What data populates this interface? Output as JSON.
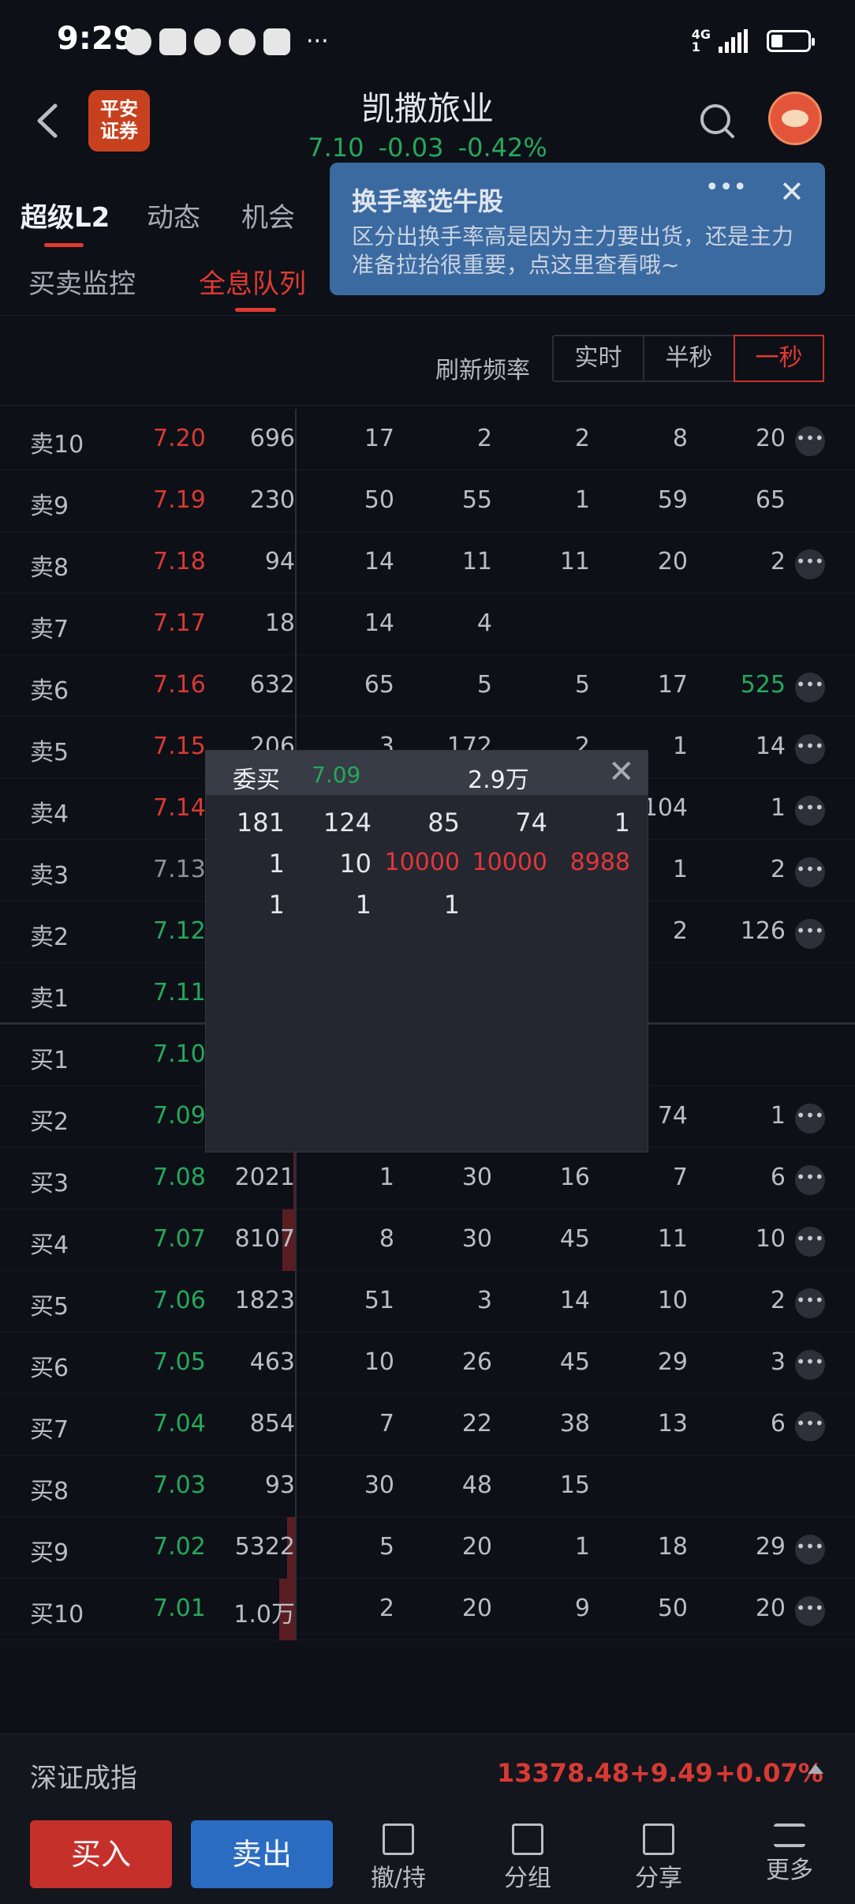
{
  "status_bar": {
    "time": "9:29",
    "network": "4G",
    "network_sub": "1"
  },
  "header": {
    "logo_line1": "平安",
    "logo_line2": "证券",
    "stock_name": "凯撒旅业",
    "price": "7.10",
    "change": "-0.03",
    "change_pct": "-0.42%"
  },
  "tabs": [
    "超级L2",
    "动态",
    "机会"
  ],
  "subtabs": [
    "买卖监控",
    "全息队列"
  ],
  "banner": {
    "title": "换手率选牛股",
    "text": "区分出换手率高是因为主力要出货，还是主力准备拉抬很重要，点这里查看哦~"
  },
  "refresh": {
    "label": "刷新频率",
    "options": [
      "实时",
      "半秒",
      "一秒"
    ],
    "selected": "一秒"
  },
  "book": {
    "rows": [
      {
        "label": "卖10",
        "price": "7.20",
        "vol": "696",
        "q": [
          "17",
          "2",
          "2",
          "8",
          "20"
        ],
        "more": true
      },
      {
        "label": "卖9",
        "price": "7.19",
        "vol": "230",
        "q": [
          "50",
          "55",
          "1",
          "59",
          "65"
        ],
        "more": false
      },
      {
        "label": "卖8",
        "price": "7.18",
        "vol": "94",
        "q": [
          "14",
          "11",
          "11",
          "20",
          "2"
        ],
        "more": true
      },
      {
        "label": "卖7",
        "price": "7.17",
        "vol": "18",
        "q": [
          "14",
          "4",
          "",
          "",
          ""
        ],
        "more": false
      },
      {
        "label": "卖6",
        "price": "7.16",
        "vol": "632",
        "q": [
          "65",
          "5",
          "5",
          "17",
          "525"
        ],
        "more": true
      },
      {
        "label": "卖5",
        "price": "7.15",
        "vol": "206",
        "q": [
          "3",
          "172",
          "2",
          "1",
          "14"
        ],
        "more": true
      },
      {
        "label": "卖4",
        "price": "7.14",
        "vol": "",
        "q": [
          "",
          "",
          "",
          "104",
          "1"
        ],
        "more": true
      },
      {
        "label": "卖3",
        "price": "7.13",
        "vol": "",
        "q": [
          "",
          "",
          "",
          "1",
          "2"
        ],
        "more": true
      },
      {
        "label": "卖2",
        "price": "7.12",
        "vol": "",
        "q": [
          "",
          "",
          "",
          "2",
          "126"
        ],
        "more": true
      },
      {
        "label": "卖1",
        "price": "7.11",
        "vol": "",
        "q": [
          "",
          "",
          "",
          "",
          ""
        ],
        "more": false
      },
      {
        "label": "买1",
        "price": "7.10",
        "vol": "",
        "q": [
          "",
          "",
          "",
          "",
          ""
        ],
        "more": false
      },
      {
        "label": "买2",
        "price": "7.09",
        "vol": "",
        "q": [
          "",
          "",
          "",
          "74",
          "1"
        ],
        "more": true
      },
      {
        "label": "买3",
        "price": "7.08",
        "vol": "2021",
        "q": [
          "1",
          "30",
          "16",
          "7",
          "6"
        ],
        "more": true
      },
      {
        "label": "买4",
        "price": "7.07",
        "vol": "8107",
        "q": [
          "8",
          "30",
          "45",
          "11",
          "10"
        ],
        "more": true
      },
      {
        "label": "买5",
        "price": "7.06",
        "vol": "1823",
        "q": [
          "51",
          "3",
          "14",
          "10",
          "2"
        ],
        "more": true
      },
      {
        "label": "买6",
        "price": "7.05",
        "vol": "463",
        "q": [
          "10",
          "26",
          "45",
          "29",
          "3"
        ],
        "more": true
      },
      {
        "label": "买7",
        "price": "7.04",
        "vol": "854",
        "q": [
          "7",
          "22",
          "38",
          "13",
          "6"
        ],
        "more": true
      },
      {
        "label": "买8",
        "price": "7.03",
        "vol": "93",
        "q": [
          "30",
          "48",
          "15",
          "",
          ""
        ],
        "more": false
      },
      {
        "label": "买9",
        "price": "7.02",
        "vol": "5322",
        "q": [
          "5",
          "20",
          "1",
          "18",
          "29"
        ],
        "more": true
      },
      {
        "label": "买10",
        "price": "7.01",
        "vol": "1.0万",
        "q": [
          "2",
          "20",
          "9",
          "50",
          "20"
        ],
        "more": true
      }
    ]
  },
  "popup": {
    "title": "委买",
    "price": "7.09",
    "total": "2.9万",
    "rows": [
      [
        "181",
        "124",
        "85",
        "74",
        "1"
      ],
      [
        "1",
        "10",
        "10000",
        "10000",
        "8988"
      ],
      [
        "1",
        "1",
        "1",
        "",
        ""
      ]
    ]
  },
  "index": {
    "name": "深证成指",
    "value": "13378.48",
    "change": "+9.49",
    "change_pct": "+0.07%"
  },
  "bottom": {
    "buy": "买入",
    "sell": "卖出",
    "actions": [
      "撤/持",
      "分组",
      "分享",
      "更多"
    ]
  },
  "colors": {
    "up": "#d83a33",
    "down": "#25a85b",
    "accent": "#e03a31",
    "sell_button": "#2b6cc3"
  }
}
